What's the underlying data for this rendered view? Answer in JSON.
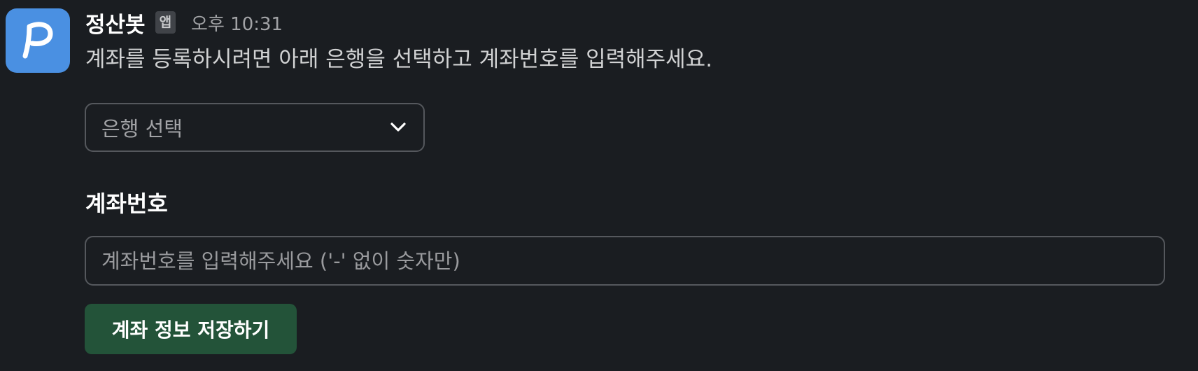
{
  "bot": {
    "name": "정산봇",
    "badge": "앱",
    "timestamp": "오후 10:31",
    "avatar_letter": "P",
    "avatar_color": "#4a90e2"
  },
  "message": {
    "text": "계좌를 등록하시려면 아래 은행을 선택하고 계좌번호를 입력해주세요."
  },
  "bank_select": {
    "placeholder": "은행 선택",
    "icon": "chevron-down-icon"
  },
  "account_field": {
    "label": "계좌번호",
    "placeholder": "계좌번호를 입력해주세요 ('-' 없이 숫자만)",
    "value": ""
  },
  "save_button": {
    "label": "계좌 정보 저장하기",
    "color": "#235339"
  },
  "theme": {
    "background": "#1a1d21",
    "border": "#55585d"
  }
}
